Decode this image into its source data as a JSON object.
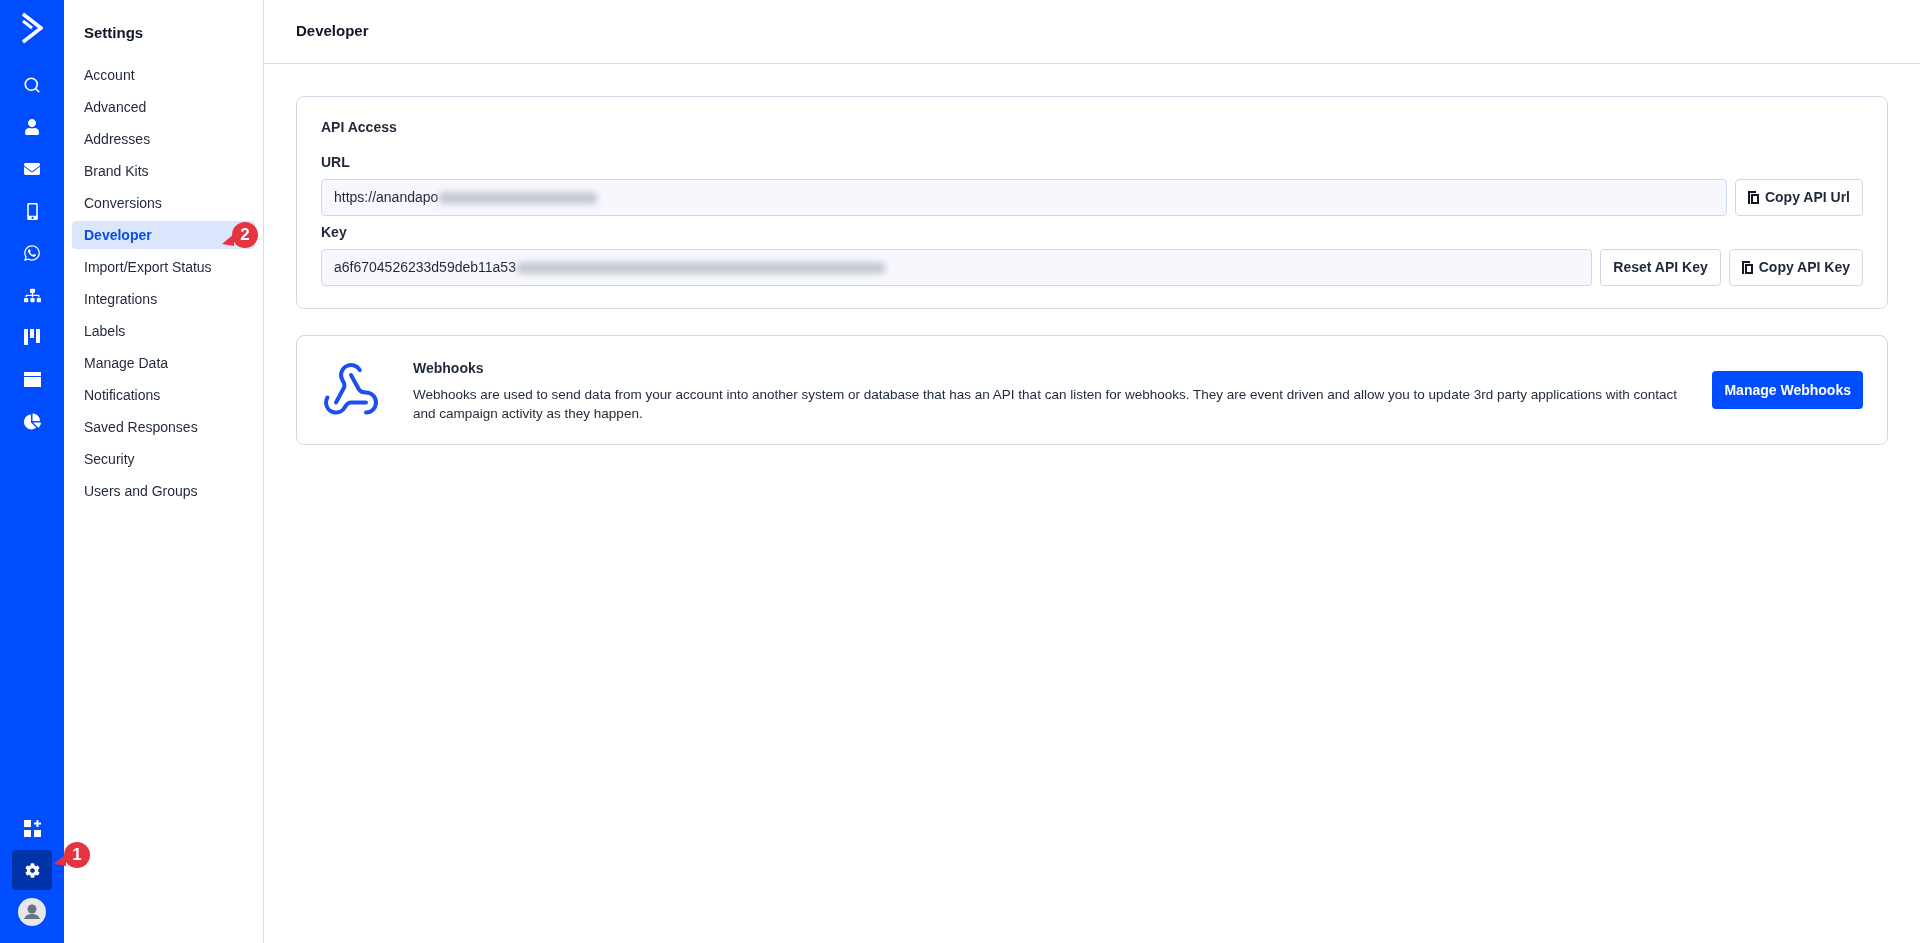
{
  "rail": {
    "top": [
      {
        "kind": "search",
        "selected": false
      },
      {
        "kind": "contacts",
        "selected": false
      },
      {
        "kind": "mail",
        "selected": false
      },
      {
        "kind": "phone",
        "selected": false
      },
      {
        "kind": "whatsapp",
        "selected": false
      },
      {
        "kind": "sitemap",
        "selected": false
      },
      {
        "kind": "kanban",
        "selected": false
      },
      {
        "kind": "window",
        "selected": false
      },
      {
        "kind": "pie",
        "selected": false
      }
    ],
    "bottom": [
      {
        "kind": "apps"
      },
      {
        "kind": "settings",
        "selected": true,
        "badge": "1"
      },
      {
        "kind": "avatar"
      }
    ]
  },
  "settings_nav": {
    "title": "Settings",
    "items": [
      {
        "label": "Account",
        "selected": false
      },
      {
        "label": "Advanced",
        "selected": false
      },
      {
        "label": "Addresses",
        "selected": false
      },
      {
        "label": "Brand Kits",
        "selected": false
      },
      {
        "label": "Conversions",
        "selected": false
      },
      {
        "label": "Developer",
        "selected": true,
        "badge": "2"
      },
      {
        "label": "Import/Export Status",
        "selected": false
      },
      {
        "label": "Integrations",
        "selected": false
      },
      {
        "label": "Labels",
        "selected": false
      },
      {
        "label": "Manage Data",
        "selected": false
      },
      {
        "label": "Notifications",
        "selected": false
      },
      {
        "label": "Saved Responses",
        "selected": false
      },
      {
        "label": "Security",
        "selected": false
      },
      {
        "label": "Users and Groups",
        "selected": false
      }
    ]
  },
  "header": {
    "title": "Developer"
  },
  "api_access": {
    "title": "API Access",
    "fields": [
      {
        "label": "URL",
        "value": "https://anandapo",
        "redacted": true,
        "buttons": [
          {
            "label": "Copy API Url",
            "kind": "copy"
          }
        ]
      },
      {
        "label": "Key",
        "value": "a6f6704526233d59deb11a53",
        "redacted": true,
        "buttons": [
          {
            "label": "Reset API Key",
            "kind": "plain"
          },
          {
            "label": "Copy API Key",
            "kind": "copy"
          }
        ]
      }
    ]
  },
  "webhooks": {
    "title": "Webhooks",
    "description": "Webhooks are used to send data from your account into another system or database that has an API that can listen for webhooks. They are event driven and allow you to update 3rd party applications with contact and campaign activity as they happen.",
    "button": "Manage Webhooks"
  }
}
